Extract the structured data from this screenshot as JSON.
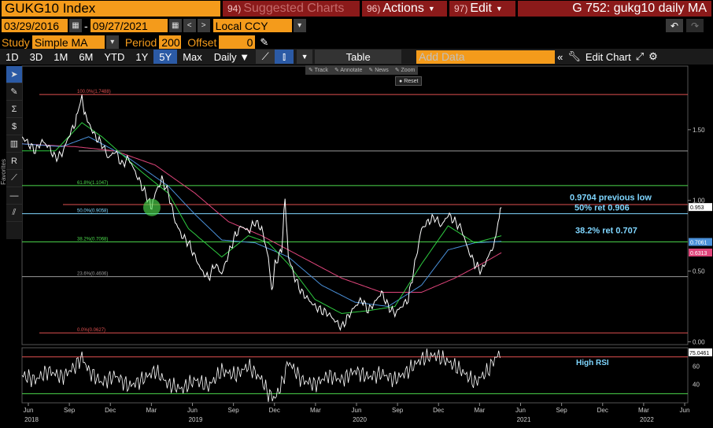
{
  "header": {
    "ticker": "GUKG10 Index",
    "suggested": {
      "num": "94)",
      "label": "Suggested Charts"
    },
    "actions": {
      "num": "96)",
      "label": "Actions"
    },
    "edit": {
      "num": "97)",
      "label": "Edit"
    },
    "chart_title": "G 752: gukg10 daily MA"
  },
  "dates": {
    "start": "03/29/2016",
    "dash": "-",
    "end": "09/27/2021",
    "currency": "Local CCY"
  },
  "study": {
    "label": "Study",
    "value": "Simple MA",
    "period_label": "Period",
    "period_value": "200",
    "offset_label": "Offset",
    "offset_value": "0"
  },
  "toolbar": {
    "ranges": [
      "1D",
      "3D",
      "1M",
      "6M",
      "YTD",
      "1Y",
      "5Y",
      "Max"
    ],
    "active_range": "5Y",
    "frequency": "Daily",
    "table_label": "Table",
    "add_data_placeholder": "Add Data",
    "edit_chart_label": "Edit Chart"
  },
  "float_toolbar": [
    "Track",
    "Annotate",
    "News",
    "Zoom"
  ],
  "reset_label": "Reset",
  "sidebar_label": "Favorites",
  "chart_data": {
    "type": "line",
    "series_main": {
      "name": "",
      "color": "#ffffff"
    },
    "ma_colors": {
      "short": "#2ecc40",
      "mid": "#4a90d9",
      "long": "#e0457b"
    },
    "y_ticks": [
      "1.50",
      "1.00",
      "0.50",
      "0.00"
    ],
    "y_values": [
      1.5,
      1.0,
      0.5,
      0.0
    ],
    "ylim": [
      -0.02,
      1.95
    ],
    "x_ticks": [
      {
        "label": "Jun",
        "year": "2018"
      },
      {
        "label": "Sep",
        "year": ""
      },
      {
        "label": "Dec",
        "year": ""
      },
      {
        "label": "Mar",
        "year": ""
      },
      {
        "label": "Jun",
        "year": "2019"
      },
      {
        "label": "Sep",
        "year": ""
      },
      {
        "label": "Dec",
        "year": ""
      },
      {
        "label": "Mar",
        "year": ""
      },
      {
        "label": "Jun",
        "year": "2020"
      },
      {
        "label": "Sep",
        "year": ""
      },
      {
        "label": "Dec",
        "year": ""
      },
      {
        "label": "Mar",
        "year": ""
      },
      {
        "label": "Jun",
        "year": "2021"
      },
      {
        "label": "Sep",
        "year": ""
      },
      {
        "label": "Dec",
        "year": ""
      },
      {
        "label": "Mar",
        "year": "2022"
      },
      {
        "label": "Jun",
        "year": ""
      }
    ],
    "fib_levels": [
      {
        "label": "100.0%(1.7488)",
        "value": 1.7488,
        "color": "#e05050"
      },
      {
        "label": "",
        "value": 1.35,
        "color": "#999999"
      },
      {
        "label": "61.8%(1.1047)",
        "value": 1.1047,
        "color": "#4cd94c"
      },
      {
        "label": "50.0%(0.9058)",
        "value": 0.9058,
        "color": "#7fd6ff"
      },
      {
        "label": "38.2%(0.7068)",
        "value": 0.7068,
        "color": "#4cd94c"
      },
      {
        "label": "23.6%(0.4606)",
        "value": 0.4606,
        "color": "#999999"
      },
      {
        "label": "0.0%(0.0627)",
        "value": 0.0627,
        "color": "#e05050"
      }
    ],
    "previous_low": {
      "value": 0.9704,
      "color": "#e05050"
    },
    "annotations": [
      {
        "text": "0.9704 previous low",
        "color": "#7fd6ff"
      },
      {
        "text": "50% ret 0.906",
        "color": "#7fd6ff"
      },
      {
        "text": "38.2% ret 0.707",
        "color": "#7fd6ff"
      }
    ],
    "last_labels": [
      {
        "text": "0.953",
        "value": 0.953,
        "bg": "#ffffff",
        "fg": "#000000"
      },
      {
        "text": "0.7061",
        "value": 0.7061,
        "bg": "#4a90d9",
        "fg": "#ffffff"
      },
      {
        "text": "0.6313",
        "value": 0.6313,
        "bg": "#e0457b",
        "fg": "#ffffff"
      }
    ],
    "main_points": [
      [
        0.0,
        1.45
      ],
      [
        0.01,
        1.4
      ],
      [
        0.02,
        1.35
      ],
      [
        0.03,
        1.42
      ],
      [
        0.04,
        1.38
      ],
      [
        0.05,
        1.3
      ],
      [
        0.06,
        1.33
      ],
      [
        0.07,
        1.45
      ],
      [
        0.08,
        1.55
      ],
      [
        0.085,
        1.65
      ],
      [
        0.09,
        1.72
      ],
      [
        0.095,
        1.6
      ],
      [
        0.1,
        1.55
      ],
      [
        0.11,
        1.45
      ],
      [
        0.12,
        1.4
      ],
      [
        0.13,
        1.3
      ],
      [
        0.14,
        1.35
      ],
      [
        0.15,
        1.25
      ],
      [
        0.16,
        1.3
      ],
      [
        0.17,
        1.2
      ],
      [
        0.18,
        1.1
      ],
      [
        0.19,
        1.0
      ],
      [
        0.195,
        0.95
      ],
      [
        0.2,
        1.05
      ],
      [
        0.21,
        1.15
      ],
      [
        0.22,
        1.05
      ],
      [
        0.23,
        0.85
      ],
      [
        0.24,
        0.75
      ],
      [
        0.25,
        0.7
      ],
      [
        0.26,
        0.6
      ],
      [
        0.27,
        0.5
      ],
      [
        0.28,
        0.45
      ],
      [
        0.29,
        0.55
      ],
      [
        0.3,
        0.48
      ],
      [
        0.31,
        0.62
      ],
      [
        0.32,
        0.75
      ],
      [
        0.33,
        0.82
      ],
      [
        0.34,
        0.78
      ],
      [
        0.35,
        0.85
      ],
      [
        0.36,
        0.8
      ],
      [
        0.37,
        0.6
      ],
      [
        0.375,
        0.35
      ],
      [
        0.38,
        0.55
      ],
      [
        0.39,
        0.65
      ],
      [
        0.395,
        1.02
      ],
      [
        0.4,
        0.6
      ],
      [
        0.41,
        0.45
      ],
      [
        0.42,
        0.35
      ],
      [
        0.43,
        0.3
      ],
      [
        0.44,
        0.25
      ],
      [
        0.45,
        0.22
      ],
      [
        0.46,
        0.2
      ],
      [
        0.47,
        0.15
      ],
      [
        0.48,
        0.1
      ],
      [
        0.49,
        0.18
      ],
      [
        0.5,
        0.25
      ],
      [
        0.51,
        0.3
      ],
      [
        0.52,
        0.22
      ],
      [
        0.53,
        0.28
      ],
      [
        0.54,
        0.35
      ],
      [
        0.55,
        0.25
      ],
      [
        0.56,
        0.2
      ],
      [
        0.57,
        0.25
      ],
      [
        0.58,
        0.3
      ],
      [
        0.59,
        0.55
      ],
      [
        0.6,
        0.8
      ],
      [
        0.61,
        0.85
      ],
      [
        0.62,
        0.88
      ],
      [
        0.63,
        0.82
      ],
      [
        0.64,
        0.9
      ],
      [
        0.65,
        0.85
      ],
      [
        0.66,
        0.8
      ],
      [
        0.67,
        0.65
      ],
      [
        0.68,
        0.55
      ],
      [
        0.69,
        0.5
      ],
      [
        0.7,
        0.6
      ],
      [
        0.71,
        0.7
      ],
      [
        0.715,
        0.85
      ],
      [
        0.72,
        0.95
      ]
    ],
    "ma_short": [
      [
        0.0,
        1.35
      ],
      [
        0.05,
        1.35
      ],
      [
        0.09,
        1.55
      ],
      [
        0.12,
        1.45
      ],
      [
        0.18,
        1.2
      ],
      [
        0.22,
        1.05
      ],
      [
        0.25,
        0.8
      ],
      [
        0.3,
        0.6
      ],
      [
        0.34,
        0.75
      ],
      [
        0.37,
        0.7
      ],
      [
        0.4,
        0.55
      ],
      [
        0.44,
        0.3
      ],
      [
        0.48,
        0.2
      ],
      [
        0.52,
        0.22
      ],
      [
        0.56,
        0.25
      ],
      [
        0.6,
        0.55
      ],
      [
        0.64,
        0.82
      ],
      [
        0.68,
        0.7
      ],
      [
        0.72,
        0.75
      ]
    ],
    "ma_mid": [
      [
        0.0,
        1.4
      ],
      [
        0.06,
        1.38
      ],
      [
        0.1,
        1.45
      ],
      [
        0.16,
        1.3
      ],
      [
        0.22,
        1.1
      ],
      [
        0.26,
        0.9
      ],
      [
        0.3,
        0.72
      ],
      [
        0.35,
        0.7
      ],
      [
        0.4,
        0.6
      ],
      [
        0.45,
        0.4
      ],
      [
        0.5,
        0.28
      ],
      [
        0.55,
        0.25
      ],
      [
        0.6,
        0.4
      ],
      [
        0.64,
        0.65
      ],
      [
        0.68,
        0.7
      ],
      [
        0.72,
        0.71
      ]
    ],
    "ma_long": [
      [
        0.0,
        1.4
      ],
      [
        0.08,
        1.38
      ],
      [
        0.14,
        1.35
      ],
      [
        0.2,
        1.25
      ],
      [
        0.26,
        1.05
      ],
      [
        0.31,
        0.85
      ],
      [
        0.36,
        0.75
      ],
      [
        0.42,
        0.6
      ],
      [
        0.48,
        0.45
      ],
      [
        0.54,
        0.35
      ],
      [
        0.6,
        0.35
      ],
      [
        0.65,
        0.45
      ],
      [
        0.69,
        0.55
      ],
      [
        0.72,
        0.63
      ]
    ],
    "rsi": {
      "label": "High RSI",
      "last_label": "75.0461",
      "y_ticks": [
        "60",
        "40"
      ],
      "y_values": [
        60,
        40
      ],
      "upper": 70,
      "lower": 30,
      "ylim": [
        20,
        80
      ],
      "points": [
        [
          0.0,
          50
        ],
        [
          0.02,
          45
        ],
        [
          0.04,
          55
        ],
        [
          0.06,
          48
        ],
        [
          0.08,
          60
        ],
        [
          0.09,
          70
        ],
        [
          0.1,
          55
        ],
        [
          0.12,
          42
        ],
        [
          0.14,
          50
        ],
        [
          0.16,
          38
        ],
        [
          0.18,
          45
        ],
        [
          0.2,
          55
        ],
        [
          0.22,
          40
        ],
        [
          0.24,
          35
        ],
        [
          0.26,
          45
        ],
        [
          0.28,
          38
        ],
        [
          0.3,
          55
        ],
        [
          0.32,
          50
        ],
        [
          0.34,
          60
        ],
        [
          0.36,
          45
        ],
        [
          0.37,
          30
        ],
        [
          0.38,
          25
        ],
        [
          0.39,
          40
        ],
        [
          0.4,
          65
        ],
        [
          0.42,
          45
        ],
        [
          0.44,
          40
        ],
        [
          0.46,
          50
        ],
        [
          0.48,
          45
        ],
        [
          0.5,
          55
        ],
        [
          0.52,
          48
        ],
        [
          0.54,
          52
        ],
        [
          0.56,
          45
        ],
        [
          0.58,
          55
        ],
        [
          0.6,
          68
        ],
        [
          0.62,
          72
        ],
        [
          0.64,
          65
        ],
        [
          0.66,
          55
        ],
        [
          0.68,
          42
        ],
        [
          0.7,
          55
        ],
        [
          0.71,
          68
        ],
        [
          0.72,
          75
        ]
      ]
    }
  }
}
